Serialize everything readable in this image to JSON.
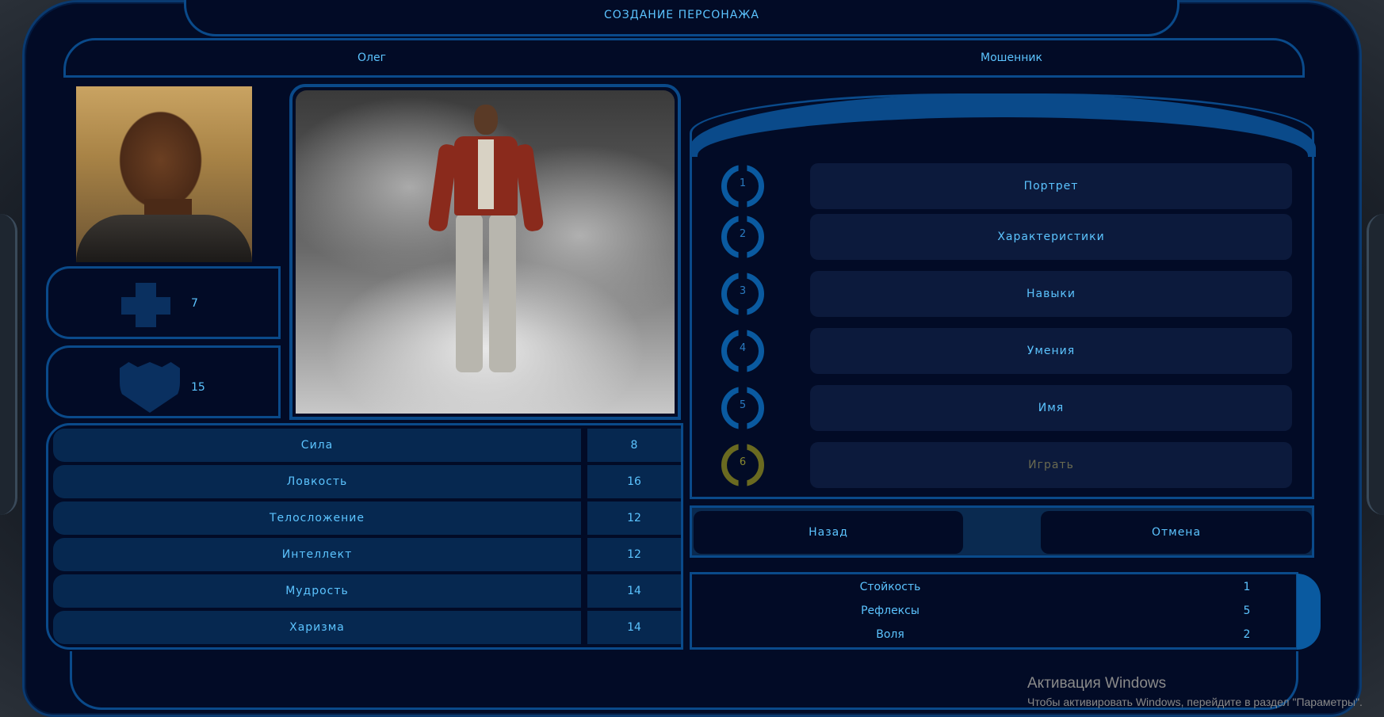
{
  "screen": {
    "title": "СОЗДАНИЕ ПЕРСОНАЖА",
    "character_name": "Олег",
    "character_class": "Мошенник"
  },
  "vitals": {
    "health_icon": "cross-icon",
    "health": "7",
    "defense_icon": "shield-icon",
    "defense": "15"
  },
  "attributes": [
    {
      "label": "Сила",
      "value": "8"
    },
    {
      "label": "Ловкость",
      "value": "16"
    },
    {
      "label": "Телосложение",
      "value": "12"
    },
    {
      "label": "Интеллект",
      "value": "12"
    },
    {
      "label": "Мудрость",
      "value": "14"
    },
    {
      "label": "Харизма",
      "value": "14"
    }
  ],
  "steps": [
    {
      "num": "1",
      "label": "Портрет",
      "enabled": true
    },
    {
      "num": "2",
      "label": "Характеристики",
      "enabled": true
    },
    {
      "num": "3",
      "label": "Навыки",
      "enabled": true
    },
    {
      "num": "4",
      "label": "Умения",
      "enabled": true
    },
    {
      "num": "5",
      "label": "Имя",
      "enabled": true
    },
    {
      "num": "6",
      "label": "Играть",
      "enabled": false
    }
  ],
  "nav": {
    "back": "Назад",
    "cancel": "Отмена"
  },
  "saves": [
    {
      "label": "Стойкость",
      "value": "1"
    },
    {
      "label": "Рефлексы",
      "value": "5"
    },
    {
      "label": "Воля",
      "value": "2"
    }
  ],
  "watermark": {
    "title": "Активация Windows",
    "subtitle": "Чтобы активировать Windows, перейдите в раздел \"Параметры\"."
  },
  "colors": {
    "accent": "#5cc4ff",
    "frame": "#0a4a8a",
    "background": "#020b26",
    "disabled": "#8a8a30"
  }
}
